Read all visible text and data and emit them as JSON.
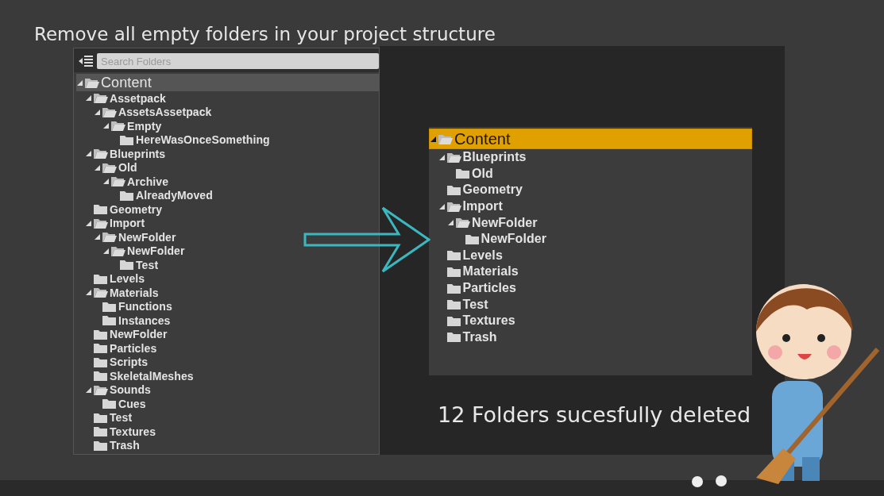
{
  "headline": "Remove all empty folders in your project structure",
  "before": {
    "search": {
      "placeholder": "Search Folders"
    },
    "tree": {
      "label": "Content",
      "selected": true,
      "expanded": true,
      "children": [
        {
          "label": "Assetpack",
          "expanded": true,
          "children": [
            {
              "label": "AssetsAssetpack",
              "expanded": true,
              "children": [
                {
                  "label": "Empty",
                  "expanded": true,
                  "children": [
                    {
                      "label": "HereWasOnceSomething",
                      "expanded": false
                    }
                  ]
                }
              ]
            }
          ]
        },
        {
          "label": "Blueprints",
          "expanded": true,
          "children": [
            {
              "label": "Old",
              "expanded": true,
              "children": [
                {
                  "label": "Archive",
                  "expanded": true,
                  "children": [
                    {
                      "label": "AlreadyMoved",
                      "expanded": false
                    }
                  ]
                }
              ]
            }
          ]
        },
        {
          "label": "Geometry",
          "expanded": false
        },
        {
          "label": "Import",
          "expanded": true,
          "children": [
            {
              "label": "NewFolder",
              "expanded": true,
              "children": [
                {
                  "label": "NewFolder",
                  "expanded": true,
                  "children": [
                    {
                      "label": "Test",
                      "expanded": false
                    }
                  ]
                }
              ]
            }
          ]
        },
        {
          "label": "Levels",
          "expanded": false
        },
        {
          "label": "Materials",
          "expanded": true,
          "children": [
            {
              "label": "Functions",
              "expanded": false
            },
            {
              "label": "Instances",
              "expanded": false
            }
          ]
        },
        {
          "label": "NewFolder",
          "expanded": false
        },
        {
          "label": "Particles",
          "expanded": false
        },
        {
          "label": "Scripts",
          "expanded": false
        },
        {
          "label": "SkeletalMeshes",
          "expanded": false
        },
        {
          "label": "Sounds",
          "expanded": true,
          "children": [
            {
              "label": "Cues",
              "expanded": false
            }
          ]
        },
        {
          "label": "Test",
          "expanded": false
        },
        {
          "label": "Textures",
          "expanded": false
        },
        {
          "label": "Trash",
          "expanded": false
        }
      ]
    }
  },
  "after": {
    "tree": {
      "label": "Content",
      "selected": true,
      "expanded": true,
      "children": [
        {
          "label": "Blueprints",
          "expanded": true,
          "children": [
            {
              "label": "Old",
              "expanded": false
            }
          ]
        },
        {
          "label": "Geometry",
          "expanded": false
        },
        {
          "label": "Import",
          "expanded": true,
          "children": [
            {
              "label": "NewFolder",
              "expanded": true,
              "children": [
                {
                  "label": "NewFolder",
                  "expanded": false
                }
              ]
            }
          ]
        },
        {
          "label": "Levels",
          "expanded": false
        },
        {
          "label": "Materials",
          "expanded": false
        },
        {
          "label": "Particles",
          "expanded": false
        },
        {
          "label": "Test",
          "expanded": false
        },
        {
          "label": "Textures",
          "expanded": false
        },
        {
          "label": "Trash",
          "expanded": false
        }
      ]
    },
    "caption": "12 Folders sucesfully deleted"
  }
}
